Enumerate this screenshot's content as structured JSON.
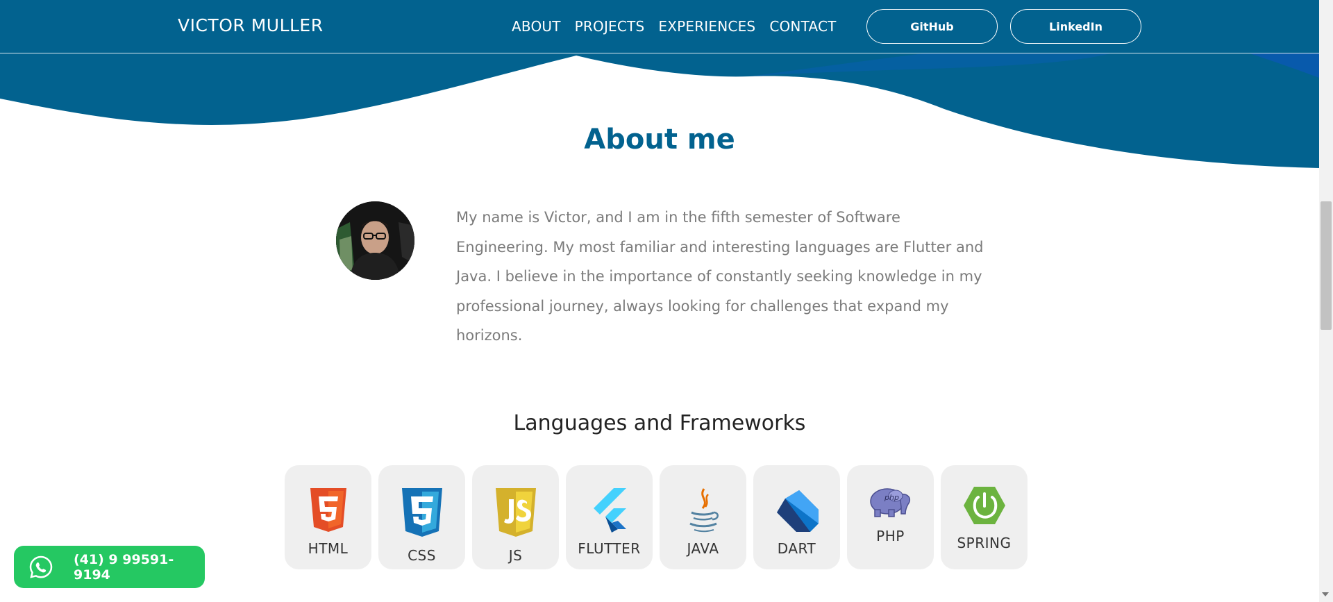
{
  "header": {
    "brand": "VICTOR MULLER",
    "nav": [
      "ABOUT",
      "PROJECTS",
      "EXPERIENCES",
      "CONTACT"
    ],
    "github_label": "GitHub",
    "linkedin_label": "LinkedIn"
  },
  "about": {
    "title": "About me",
    "text": "My name is Victor, and I am in the fifth semester of Software Engineering. My most familiar and interesting languages are Flutter and Java. I believe in the importance of constantly seeking knowledge in my professional journey, always looking for challenges that expand my horizons."
  },
  "skills": {
    "title": "Languages and Frameworks",
    "items": [
      {
        "label": "HTML",
        "icon": "html5-icon"
      },
      {
        "label": "CSS",
        "icon": "css3-icon"
      },
      {
        "label": "JS",
        "icon": "javascript-icon"
      },
      {
        "label": "FLUTTER",
        "icon": "flutter-icon"
      },
      {
        "label": "JAVA",
        "icon": "java-icon"
      },
      {
        "label": "DART",
        "icon": "dart-icon"
      },
      {
        "label": "PHP",
        "icon": "php-icon"
      },
      {
        "label": "SPRING",
        "icon": "spring-icon"
      }
    ]
  },
  "whatsapp": {
    "phone": "(41) 9 99591-9194",
    "icon": "whatsapp-icon"
  },
  "colors": {
    "primary": "#02628f",
    "whatsapp": "#25c862",
    "tile": "#efefef"
  }
}
